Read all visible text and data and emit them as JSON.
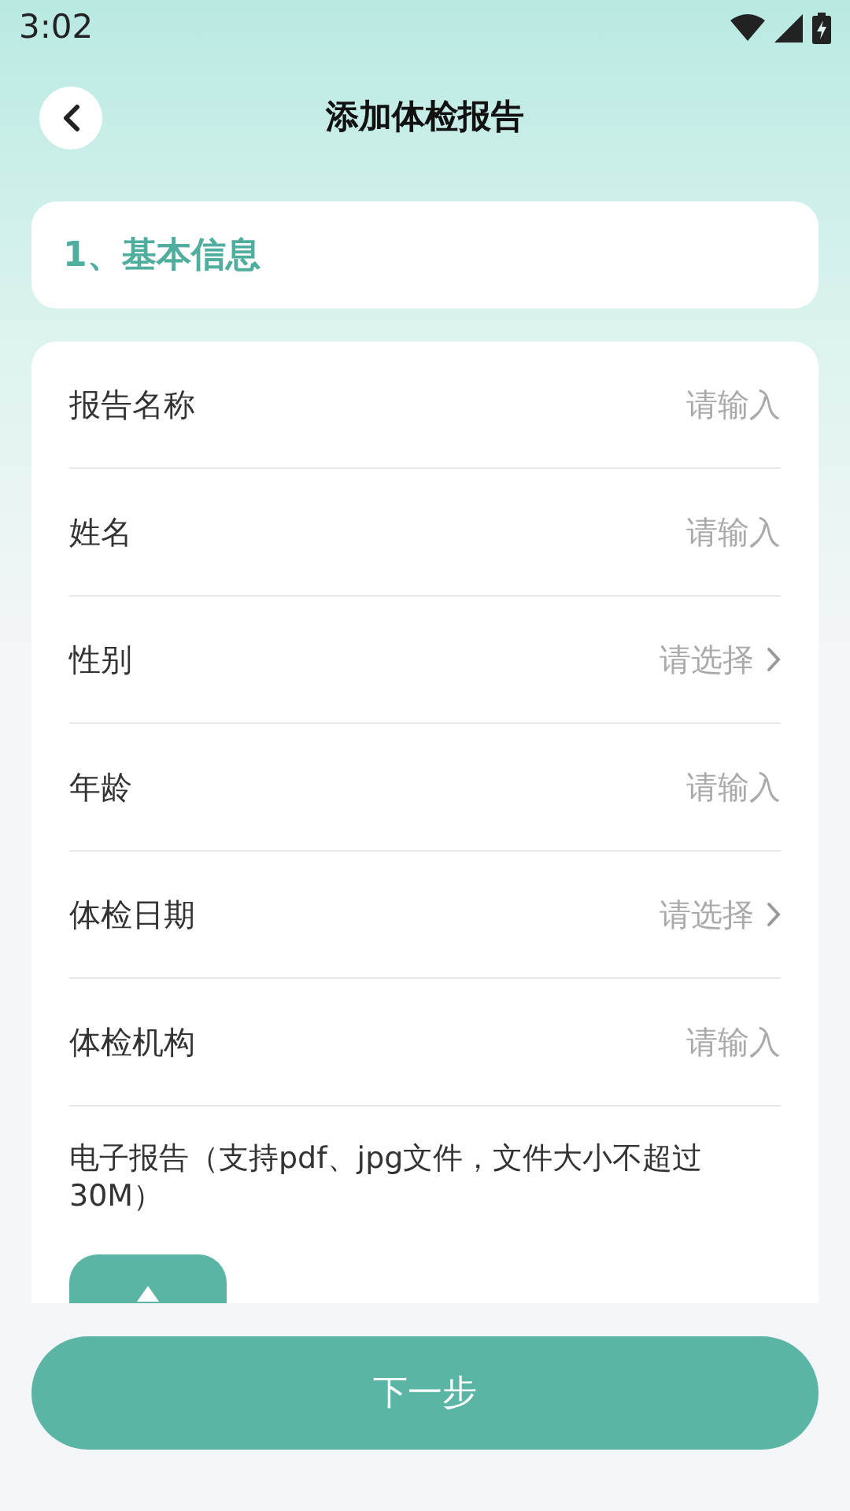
{
  "status_bar": {
    "time": "3:02"
  },
  "header": {
    "title": "添加体检报告"
  },
  "section": {
    "title": "1、基本信息"
  },
  "fields": [
    {
      "kind": "input",
      "label": "报告名称",
      "placeholder": "请输入"
    },
    {
      "kind": "input",
      "label": "姓名",
      "placeholder": "请输入"
    },
    {
      "kind": "select",
      "label": "性别",
      "placeholder": "请选择"
    },
    {
      "kind": "input",
      "label": "年龄",
      "placeholder": "请输入"
    },
    {
      "kind": "select",
      "label": "体检日期",
      "placeholder": "请选择"
    },
    {
      "kind": "input",
      "label": "体检机构",
      "placeholder": "请输入"
    }
  ],
  "upload": {
    "label": "电子报告（支持pdf、jpg文件，文件大小不超过30M）"
  },
  "next_button": {
    "label": "下一步"
  }
}
